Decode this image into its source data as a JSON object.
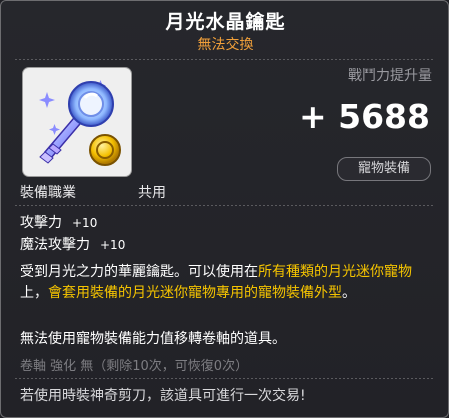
{
  "item": {
    "name": "月光水晶鑰匙",
    "trade_status": "無法交換"
  },
  "power": {
    "label": "戰鬥力提升量",
    "value": "+ 5688"
  },
  "category_badge": "寵物裝備",
  "job": {
    "label": "裝備職業",
    "value": "共用"
  },
  "stats": [
    {
      "label": "攻擊力",
      "value": "+10"
    },
    {
      "label": "魔法攻擊力",
      "value": "+10"
    }
  ],
  "description": {
    "part1": "受到月光之力的華麗鑰匙。可以使用在",
    "hl1": "所有種類的月光迷你寵物",
    "part2": "上，",
    "hl2": "會套用裝備的月光迷你寵物專用的寵物裝備外型",
    "part3": "。"
  },
  "description2": "無法使用寵物裝備能力值移轉卷軸的道具。",
  "scroll_info": "卷軸 強化 無（剩除10次，可恢復0次）",
  "scissor_info": "若使用時裝神奇剪刀，該道具可進行一次交易!",
  "colors": {
    "title": "#ffffff",
    "trade_status": "#f2a03a",
    "highlight": "#f5c400",
    "muted": "#7d7d82",
    "background": "#222227"
  },
  "icons": {
    "item": "crystal-key-icon",
    "coin": "gold-coin-icon"
  }
}
